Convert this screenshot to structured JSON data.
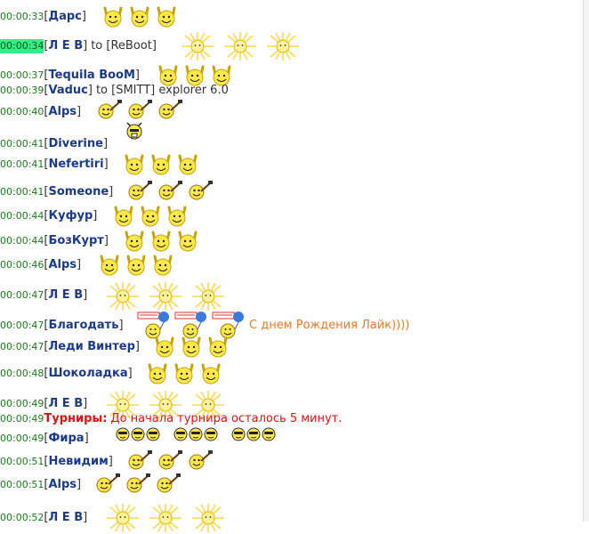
{
  "messages": [
    {
      "time": "00:00:33",
      "nick": "Дарс",
      "smileys": [
        "rock",
        "rock",
        "rock"
      ]
    },
    {
      "time": "00:00:34",
      "highlight": true,
      "nick": "Л Е В",
      "to": "to [ReBoot]",
      "smileys": [
        "glow",
        "glow",
        "glow"
      ]
    },
    {
      "time": "00:00:37",
      "nick": "Tequila BooM",
      "smileys": [
        "rock",
        "rock",
        "rock"
      ]
    },
    {
      "time": "00:00:39",
      "nick": "Vaduc",
      "to": "to [SMITT] explorer 6.0",
      "smileys": []
    },
    {
      "time": "00:00:40",
      "nick": "Alps",
      "smileys": [
        "guitar",
        "guitar",
        "guitar"
      ]
    },
    {
      "time": "",
      "nick": "",
      "smileys": [
        "dude"
      ]
    },
    {
      "time": "00:00:41",
      "nick": "Diverine",
      "smileys": []
    },
    {
      "time": "00:00:41",
      "nick": "Nefertiri",
      "smileys": [
        "rock",
        "rock",
        "rock"
      ]
    },
    {
      "time": "00:00:41",
      "nick": "Someone",
      "smileys": [
        "guitar",
        "guitar",
        "guitar"
      ]
    },
    {
      "time": "00:00:44",
      "nick": "Куфур",
      "smileys": [
        "rock",
        "rock",
        "rock"
      ]
    },
    {
      "time": "00:00:44",
      "nick": "БозКурт",
      "smileys": [
        "rock",
        "rock",
        "rock"
      ]
    },
    {
      "time": "00:00:46",
      "nick": "Alps",
      "smileys": [
        "rock",
        "rock",
        "rock"
      ]
    },
    {
      "time": "00:00:47",
      "nick": "Л Е В",
      "smileys": [
        "glow",
        "glow",
        "glow"
      ]
    },
    {
      "time": "00:00:47",
      "nick": "Благодать",
      "smileys": [
        "balloon",
        "balloon",
        "balloon"
      ],
      "text": "С днем Рождения Лайк))))",
      "text_style": "orange"
    },
    {
      "time": "00:00:47",
      "nick": "Леди Винтер",
      "smileys": [
        "rock",
        "rock",
        "rock"
      ]
    },
    {
      "time": "00:00:48",
      "nick": "Шоколадка",
      "smileys": [
        "rock",
        "rock",
        "rock"
      ]
    },
    {
      "time": "00:00:49",
      "nick": "Л Е В",
      "smileys": [
        "glow",
        "glow",
        "glow"
      ]
    },
    {
      "time": "00:00:49",
      "nick": "Турниры:",
      "system": true,
      "text": "До начала турнира осталось 5 минут.",
      "text_style": "red"
    },
    {
      "time": "00:00:49",
      "nick": "Фира",
      "smileys": [
        "suns",
        "suns",
        "suns"
      ]
    },
    {
      "time": "00:00:51",
      "nick": "Невидим",
      "smileys": [
        "guitar",
        "guitar",
        "guitar"
      ]
    },
    {
      "time": "00:00:51",
      "nick": "Alps",
      "smileys": [
        "guitar",
        "guitar",
        "guitar"
      ]
    },
    {
      "time": "00:00:52",
      "nick": "Л Е В",
      "smileys": [
        "glow",
        "glow",
        "glow"
      ]
    }
  ]
}
